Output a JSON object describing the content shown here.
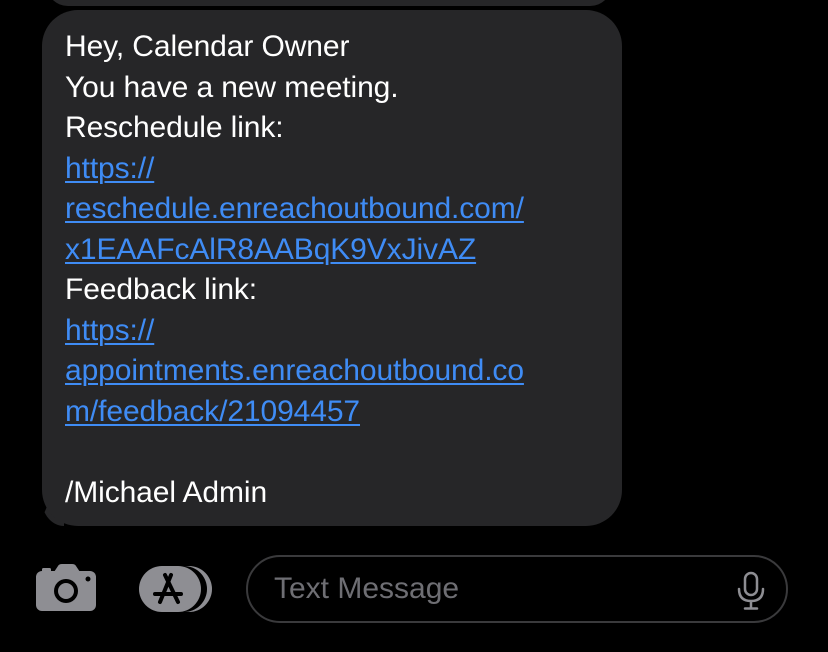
{
  "message": {
    "lines": [
      {
        "text": "Hey, Calendar Owner",
        "type": "text"
      },
      {
        "text": "You have a new meeting.",
        "type": "text"
      },
      {
        "text": "Reschedule link:",
        "type": "text"
      },
      {
        "text": "https://",
        "type": "link"
      },
      {
        "text": "reschedule.enreachoutbound.com/",
        "type": "link"
      },
      {
        "text": "x1EAAFcAlR8AABqK9VxJivAZ",
        "type": "link"
      },
      {
        "text": "Feedback link:",
        "type": "text"
      },
      {
        "text": "https://",
        "type": "link"
      },
      {
        "text": "appointments.enreachoutbound.co",
        "type": "link"
      },
      {
        "text": "m/feedback/21094457",
        "type": "link"
      },
      {
        "text": "",
        "type": "blank"
      },
      {
        "text": "/Michael Admin",
        "type": "text"
      }
    ]
  },
  "composer": {
    "placeholder": "Text Message",
    "value": "",
    "camera_icon": "camera-icon",
    "apps_icon": "app-store-icon",
    "mic_icon": "microphone-icon"
  },
  "colors": {
    "background": "#000000",
    "bubble": "#262628",
    "link": "#3f8cf5",
    "text": "#ffffff",
    "icon": "#8e8e93",
    "placeholder": "#6e6e73"
  }
}
